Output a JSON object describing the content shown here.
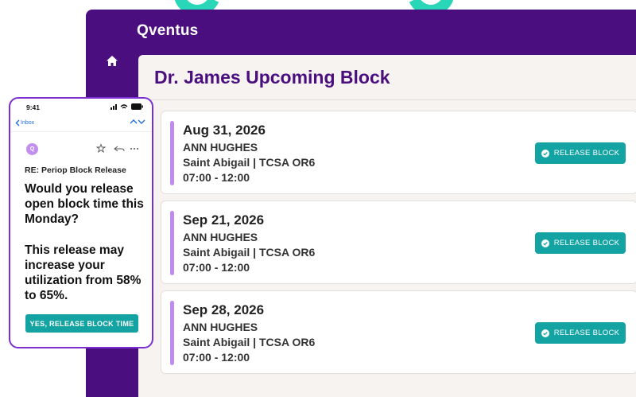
{
  "app": {
    "brand": "Qventus",
    "page_title": "Dr. James Upcoming Block"
  },
  "blocks": [
    {
      "date": "Aug 31, 2026",
      "surgeon": "ANN HUGHES",
      "location": "Saint Abigail | TCSA OR6",
      "time": "07:00 - 12:00",
      "button_label": "RELEASE BLOCK"
    },
    {
      "date": "Sep 21, 2026",
      "surgeon": "ANN HUGHES",
      "location": "Saint Abigail | TCSA OR6",
      "time": "07:00 - 12:00",
      "button_label": "RELEASE BLOCK"
    },
    {
      "date": "Sep 28, 2026",
      "surgeon": "ANN HUGHES",
      "location": "Saint Abigail | TCSA OR6",
      "time": "07:00 - 12:00",
      "button_label": "RELEASE BLOCK"
    }
  ],
  "phone": {
    "time": "9:41",
    "back_label": "Inbox",
    "avatar_initial": "Q",
    "subject": "RE: Periop Block Release",
    "question": "Would you release open block time this Monday?",
    "note": "This release may increase your utilization from 58% to 65%.",
    "cta_label": "YES, RELEASE BLOCK TIME"
  },
  "colors": {
    "brand_purple": "#4a0e7e",
    "teal_button": "#13a3a3",
    "accent_bar": "#c08bf0",
    "decor_teal": "#2ad6b8"
  },
  "icons": {
    "nav": "home-icon",
    "button": "check-circle-icon",
    "status": "signal-wifi-battery-icon",
    "mail": [
      "star-icon",
      "reply-icon",
      "more-icon"
    ]
  }
}
